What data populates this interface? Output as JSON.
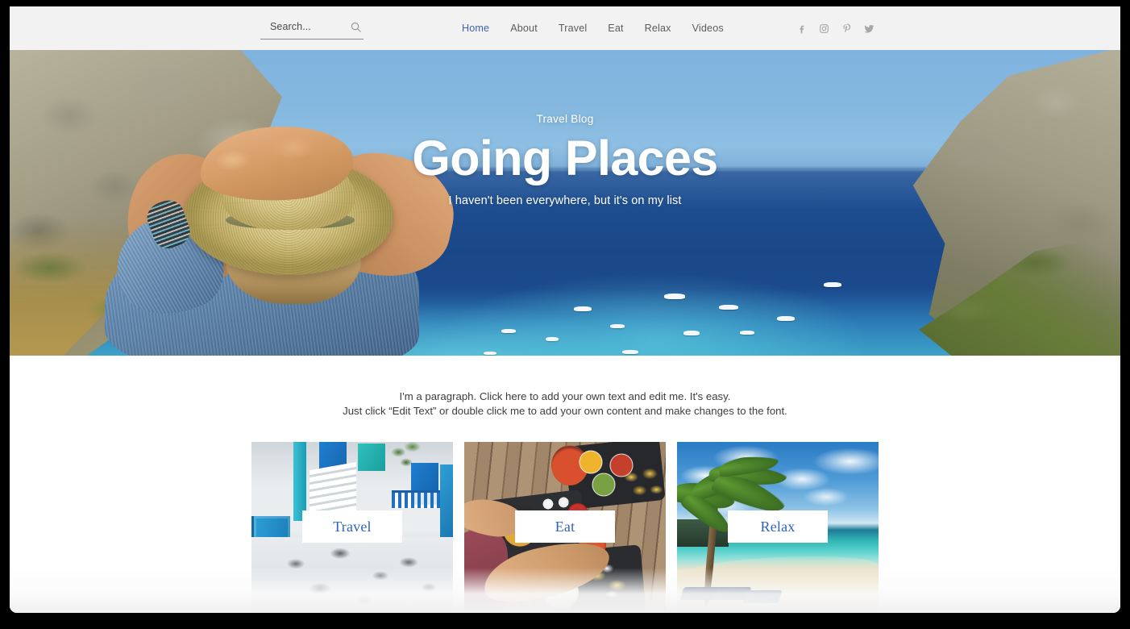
{
  "header": {
    "search": {
      "placeholder": "Search...",
      "value": "",
      "icon": "search-icon"
    },
    "nav": [
      {
        "label": "Home",
        "active": true
      },
      {
        "label": "About",
        "active": false
      },
      {
        "label": "Travel",
        "active": false
      },
      {
        "label": "Eat",
        "active": false
      },
      {
        "label": "Relax",
        "active": false
      },
      {
        "label": "Videos",
        "active": false
      }
    ],
    "social": [
      {
        "name": "facebook-icon"
      },
      {
        "name": "instagram-icon"
      },
      {
        "name": "pinterest-icon"
      },
      {
        "name": "twitter-icon"
      }
    ],
    "background_color": "#f2f2f2",
    "active_nav_color": "#3f64ad"
  },
  "hero": {
    "eyebrow": "Travel Blog",
    "title": "Going Places",
    "subtitle": "I haven't been everywhere, but it's on my list",
    "text_color": "#ffffff",
    "image_alt": "Woman in straw hat overlooking a blue bay with yachts"
  },
  "content": {
    "paragraph_line_1": "I'm a paragraph. Click here to add your own text and edit me. It's easy.",
    "paragraph_line_2": "Just click “Edit Text” or double click me to add your own content and make changes to the font.",
    "cards": [
      {
        "label": "Travel",
        "image_alt": "Blue doors in a whitewashed Greek alley"
      },
      {
        "label": "Eat",
        "image_alt": "Overhead view of food platters on a wooden table"
      },
      {
        "label": "Relax",
        "image_alt": "Palm tree on a tropical white sand beach"
      }
    ],
    "card_label_color": "#2b62c4",
    "card_label_background": "#ffffff"
  }
}
